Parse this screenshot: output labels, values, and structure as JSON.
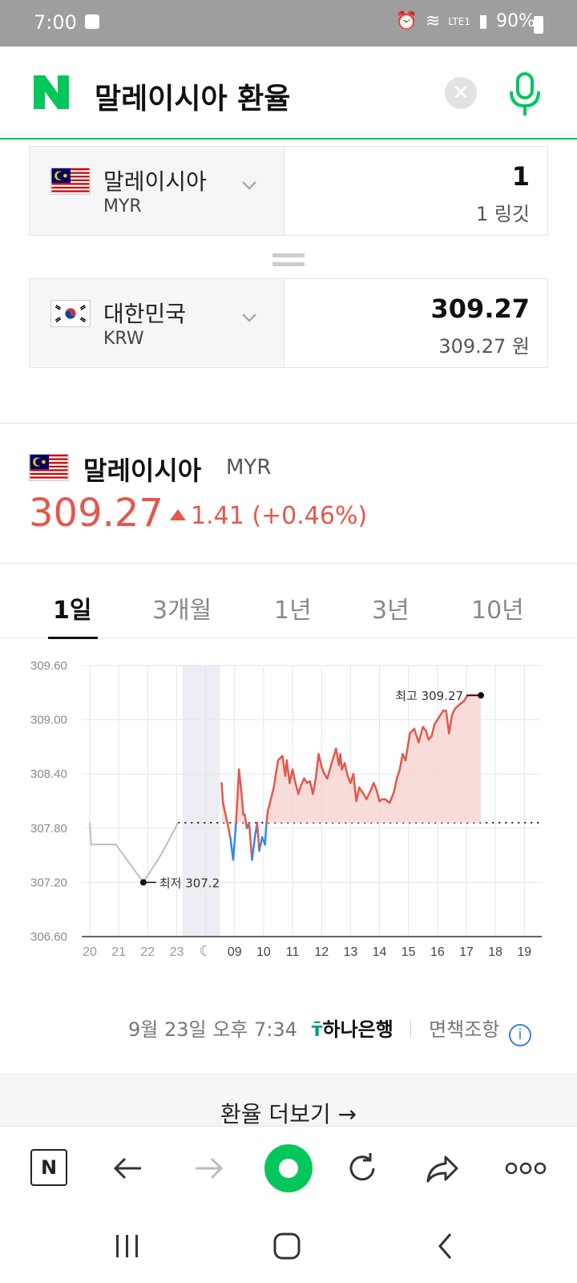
{
  "status": {
    "time": "7:00",
    "battery": "90%",
    "lte": "LTE1"
  },
  "search": {
    "query": "말레이시아 환율"
  },
  "converter": {
    "from": {
      "name": "말레이시아",
      "code": "MYR",
      "amount": "1",
      "amount_text": "1 링깃"
    },
    "to": {
      "name": "대한민국",
      "code": "KRW",
      "amount": "309.27",
      "amount_text": "309.27 원"
    }
  },
  "rate": {
    "name": "말레이시아",
    "code": "MYR",
    "value": "309.27",
    "change": "1.41 (+0.46%)",
    "up_color": "#e5574b",
    "down_color": "#2f8be8"
  },
  "tabs": [
    {
      "label": "1일",
      "active": true
    },
    {
      "label": "3개월",
      "active": false
    },
    {
      "label": "1년",
      "active": false
    },
    {
      "label": "3년",
      "active": false
    },
    {
      "label": "10년",
      "active": false
    }
  ],
  "chart_data": {
    "type": "line",
    "ylim": [
      306.6,
      309.6
    ],
    "yticks": [
      "309.60",
      "309.00",
      "308.40",
      "307.80",
      "307.20",
      "306.60"
    ],
    "xticks": [
      "20",
      "21",
      "22",
      "23",
      "moon-icon",
      "09",
      "10",
      "11",
      "12",
      "13",
      "14",
      "15",
      "16",
      "17",
      "18",
      "19"
    ],
    "baseline": 307.86,
    "annotations": {
      "high": "최고 309.27",
      "low": "최저 307.2"
    },
    "series": [
      {
        "segment": "previous-days",
        "x": [
          0,
          0.05,
          0.9,
          1.85,
          2.45,
          3.05
        ],
        "y": [
          307.86,
          307.62,
          307.62,
          307.2,
          307.5,
          307.86
        ]
      },
      {
        "segment": "today",
        "x": [
          4.55,
          4.6,
          4.75,
          4.85,
          4.95,
          5.05,
          5.15,
          5.2,
          5.25,
          5.3,
          5.35,
          5.42,
          5.5,
          5.6,
          5.7,
          5.78,
          5.85,
          5.95,
          6.05,
          6.1,
          6.15,
          6.2,
          6.25,
          6.35,
          6.5,
          6.65,
          6.75,
          6.8,
          6.9,
          7.0,
          7.1,
          7.2,
          7.3,
          7.4,
          7.5,
          7.6,
          7.7,
          7.8,
          7.9,
          8.0,
          8.1,
          8.2,
          8.35,
          8.5,
          8.6,
          8.65,
          8.7,
          8.8,
          8.9,
          9.0,
          9.1,
          9.2,
          9.3,
          9.45,
          9.55,
          9.7,
          9.8,
          9.9,
          10.0,
          10.1,
          10.2,
          10.35,
          10.5,
          10.6,
          10.7,
          10.8,
          10.9,
          11.05,
          11.2,
          11.35,
          11.5,
          11.6,
          11.7,
          11.8,
          11.9,
          12.0,
          12.1,
          12.2,
          12.3,
          12.4,
          12.5,
          12.6,
          12.7,
          12.8,
          12.9,
          13.0,
          13.05,
          13.1,
          13.2,
          13.35,
          13.5
        ],
        "y": [
          308.3,
          308.08,
          307.86,
          307.7,
          307.45,
          307.86,
          308.45,
          308.3,
          308.15,
          307.95,
          307.95,
          307.8,
          307.86,
          307.45,
          307.7,
          307.86,
          307.55,
          307.7,
          307.62,
          307.86,
          308.0,
          308.05,
          308.12,
          308.25,
          308.55,
          308.6,
          308.38,
          308.55,
          308.3,
          308.45,
          308.3,
          308.18,
          308.28,
          308.35,
          308.3,
          308.32,
          308.18,
          308.35,
          308.62,
          308.48,
          308.4,
          308.35,
          308.52,
          308.68,
          308.5,
          308.62,
          308.45,
          308.52,
          308.38,
          308.3,
          308.4,
          308.1,
          308.25,
          308.18,
          308.12,
          308.22,
          308.3,
          308.22,
          308.1,
          308.12,
          308.12,
          308.08,
          308.2,
          308.35,
          308.45,
          308.62,
          308.55,
          308.85,
          308.9,
          308.75,
          308.92,
          308.88,
          308.78,
          308.82,
          308.95,
          309.0,
          309.05,
          309.1,
          309.1,
          308.85,
          309.05,
          309.12,
          309.15,
          309.18,
          309.2,
          309.25,
          309.27,
          309.27,
          309.27,
          309.27,
          309.27
        ]
      }
    ]
  },
  "source": {
    "date": "9월 23일 오후 7:34",
    "bank": "하나은행",
    "disclaimer": "면책조항"
  },
  "more": {
    "label": "환율 더보기 →"
  }
}
